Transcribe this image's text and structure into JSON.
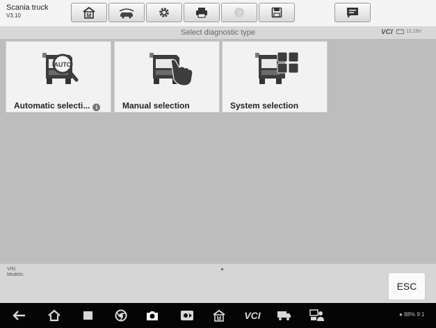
{
  "app": {
    "title": "Scania truck",
    "version": "V3.10"
  },
  "toolbar": {
    "items": [
      {
        "name": "home",
        "icon": "home-m-icon"
      },
      {
        "name": "vehicle-swap",
        "icon": "vehicle-swap-icon"
      },
      {
        "name": "settings",
        "icon": "gear-icon"
      },
      {
        "name": "print",
        "icon": "printer-icon"
      },
      {
        "name": "help",
        "icon": "help-icon",
        "disabled": true
      },
      {
        "name": "save",
        "icon": "save-icon"
      },
      {
        "name": "data-logging",
        "icon": "message-icon"
      }
    ]
  },
  "subheader": {
    "title": "Select diagnostic type",
    "vci_label": "VCI",
    "voltage": "12.19V"
  },
  "options": [
    {
      "label": "Automatic selecti...",
      "icon": "truck-auto-icon",
      "has_info": true
    },
    {
      "label": "Manual selection",
      "icon": "truck-hand-icon",
      "has_info": false
    },
    {
      "label": "System selection",
      "icon": "truck-grid-icon",
      "has_info": false
    }
  ],
  "info": {
    "vin_label": "VIN:",
    "models_label": "Models:"
  },
  "esc_label": "ESC",
  "navbar": {
    "icons": [
      "back-icon",
      "home-icon",
      "recent-apps-icon",
      "chrome-icon",
      "camera-icon",
      "screen-record-icon",
      "maxisys-home-icon",
      "vci-icon",
      "truck-icon",
      "remote-support-icon"
    ],
    "vci_text": "VCI",
    "status": "88% 9:1"
  },
  "colors": {
    "toolbar_bg": "#f4f4f4",
    "content_bg": "#bdbdbd",
    "navbar_bg": "#050505"
  }
}
